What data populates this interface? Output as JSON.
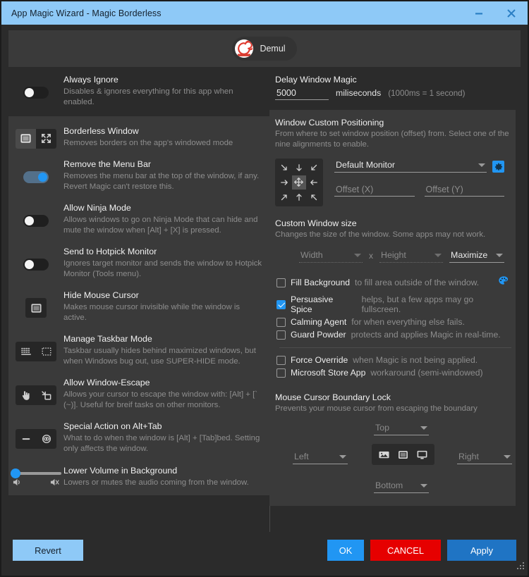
{
  "titlebar": {
    "title": "App Magic Wizard - Magic Borderless",
    "minimize_icon": "minimize-icon",
    "close_icon": "close-icon"
  },
  "app_header": {
    "name": "Demul",
    "icon": "demul-app-icon"
  },
  "left_options": [
    {
      "id": "always-ignore",
      "title": "Always Ignore",
      "desc": "Disables & ignores everything for this app when enabled.",
      "control": "toggle",
      "state": "off"
    },
    {
      "id": "borderless-window",
      "title": "Borderless Window",
      "desc": "Removes borders on the app's windowed mode",
      "control": "icon-pair",
      "icons": [
        "window-icon",
        "fullscreen-expand-icon"
      ],
      "selected": 0
    },
    {
      "id": "remove-menu-bar",
      "title": "Remove the Menu Bar",
      "desc": "Removes the menu bar at the top of the window, if any. Revert Magic can't restore this.",
      "control": "toggle",
      "state": "on"
    },
    {
      "id": "allow-ninja-mode",
      "title": "Allow Ninja Mode",
      "desc": "Allows windows to go on Ninja Mode that can hide and mute the window when [Alt] + [X] is pressed.",
      "control": "toggle",
      "state": "off"
    },
    {
      "id": "send-to-hotpick-monitor",
      "title": "Send to Hotpick Monitor",
      "desc": "Ignores target monitor and sends the window to Hotpick Monitor (Tools menu).",
      "control": "toggle",
      "state": "off"
    },
    {
      "id": "hide-mouse-cursor",
      "title": "Hide Mouse Cursor",
      "desc": "Makes mouse cursor invisible while the window is active.",
      "control": "icon-single",
      "icons": [
        "window-icon"
      ]
    },
    {
      "id": "manage-taskbar-mode",
      "title": "Manage Taskbar Mode",
      "desc": "Taskbar usually hides behind maximized windows, but when Windows bug out, use SUPER-HIDE mode.",
      "control": "icon-pair",
      "icons": [
        "dotted-taskbar-icon",
        "dotted-rectangle-icon"
      ],
      "selected": -1
    },
    {
      "id": "allow-window-escape",
      "title": "Allow Window-Escape",
      "desc": "Allows your cursor to escape the window with: [Alt] + [` (~)]. Useful for breif tasks on other monitors.",
      "control": "icon-pair",
      "icons": [
        "pointing-hand-icon",
        "escape-arrow-icon"
      ],
      "selected": -1
    },
    {
      "id": "special-action-alt-tab",
      "title": "Special Action on Alt+Tab",
      "desc": "What to do when the window is [Alt] + [Tab]bed. Setting only affects the window.",
      "control": "icon-pair",
      "icons": [
        "dash-icon",
        "eye-icon"
      ],
      "selected": -1
    },
    {
      "id": "lower-volume-in-background",
      "title": "Lower Volume in Background",
      "desc": "Lowers or mutes the audio coming from the window.",
      "control": "slider",
      "value": 0,
      "icons": [
        "volume-on-icon",
        "volume-muted-icon"
      ]
    }
  ],
  "delay": {
    "title": "Delay Window Magic",
    "value": "5000",
    "unit": "miliseconds",
    "hint": "(1000ms = 1 second)"
  },
  "positioning": {
    "title": "Window Custom Positioning",
    "desc": "From where to set window position (offset) from. Select one of the nine alignments to enable.",
    "grid_icons": [
      "arrow-down-right-icon",
      "arrow-down-icon",
      "arrow-down-left-icon",
      "arrow-right-icon",
      "move-icon",
      "arrow-left-icon",
      "arrow-up-right-icon",
      "arrow-up-icon",
      "arrow-up-left-icon"
    ],
    "grid_selected": 4,
    "monitor_value": "Default Monitor",
    "gear_icon": "gear-icon",
    "offset_x_placeholder": "Offset (X)",
    "offset_y_placeholder": "Offset (Y)"
  },
  "window_size": {
    "title": "Custom Window size",
    "desc": "Changes the size of the window. Some apps may not work.",
    "width_placeholder": "Width",
    "separator": "x",
    "height_placeholder": "Height",
    "mode_value": "Maximize"
  },
  "checkboxes_group1": [
    {
      "id": "fill-background",
      "label": "Fill Background",
      "desc": "to fill area outside of the window.",
      "checked": false,
      "trailing_icon": "palette-icon"
    },
    {
      "id": "persuasive-spice",
      "label": "Persuasive Spice",
      "desc": "helps, but a few apps may go fullscreen.",
      "checked": true
    },
    {
      "id": "calming-agent",
      "label": "Calming Agent",
      "desc": "for when everything else fails.",
      "checked": false
    },
    {
      "id": "guard-powder",
      "label": "Guard Powder",
      "desc": "protects and applies Magic in real-time.",
      "checked": false
    }
  ],
  "checkboxes_group2": [
    {
      "id": "force-override",
      "label": "Force Override",
      "desc": "when Magic is not being applied.",
      "checked": false
    },
    {
      "id": "microsoft-store-app",
      "label": "Microsoft Store App",
      "desc": "workaround (semi-windowed)",
      "checked": false
    }
  ],
  "boundary_lock": {
    "title": "Mouse Cursor Boundary Lock",
    "desc": "Prevents your mouse cursor from escaping the boundary",
    "top": "Top",
    "bottom": "Bottom",
    "left": "Left",
    "right": "Right",
    "center_icons": [
      "picture-icon",
      "window-icon",
      "monitor-icon"
    ]
  },
  "footer": {
    "revert": "Revert",
    "ok": "OK",
    "cancel": "CANCEL",
    "apply": "Apply",
    "grip_icon": "resize-grip-icon"
  },
  "colors": {
    "titlebar": "#8ec9f7",
    "accent": "#2196f3",
    "cancel": "#e60000",
    "apply": "#1f74c4",
    "panel": "#3a3a3a",
    "dark": "#2b2b2b"
  }
}
